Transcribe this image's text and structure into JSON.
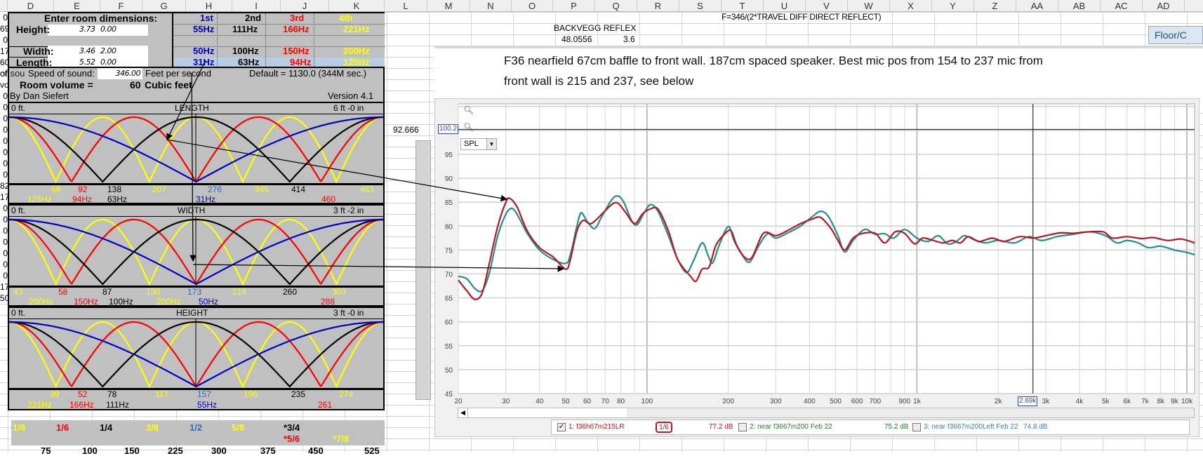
{
  "columns": [
    "D",
    "E",
    "F",
    "G",
    "H",
    "I",
    "J",
    "K",
    "L",
    "M",
    "N",
    "O",
    "P",
    "Q",
    "R",
    "S",
    "T",
    "U",
    "V",
    "W",
    "X",
    "Y",
    "Z",
    "AA",
    "AB",
    "AC",
    "AD"
  ],
  "row_headers": [
    "0",
    "69",
    "0",
    "17",
    "60",
    "of sou",
    "volu",
    "0",
    "0",
    "0",
    "0",
    "0",
    "0",
    "0",
    "0",
    "82",
    "17",
    "0",
    "0",
    "0",
    "0",
    "0",
    "0",
    "0",
    "17",
    "50"
  ],
  "room": {
    "title": "Enter room dimensions:",
    "harmonics": [
      "1st",
      "2nd",
      "3rd",
      "4th"
    ],
    "height": {
      "label": "Height:",
      "meters": "3.73",
      "offset": "0.00",
      "modes": [
        "55Hz",
        "111Hz",
        "166Hz",
        "221Hz"
      ]
    },
    "width": {
      "label": "Width:",
      "meters": "3.46",
      "offset": "2.00",
      "modes": [
        "50Hz",
        "100Hz",
        "150Hz",
        "200Hz"
      ]
    },
    "length": {
      "label": "Length:",
      "meters": "5.52",
      "offset": "0.00",
      "modes": [
        "31Hz",
        "63Hz",
        "94Hz",
        "125Hz"
      ]
    },
    "speed_label": "Speed of sound:",
    "speed_overlap": "of sou",
    "speed": "346.00",
    "speed_unit": "Feet per second",
    "speed_default": "Default = 1130.0 (344M sec.)",
    "volume_label": "Room volume =",
    "volume": "60",
    "volume_unit": "Cubic feet",
    "author": "By Dan Siefert",
    "version": "Version 4.1"
  },
  "panels": {
    "length": {
      "title": "LENGTH",
      "start": "0 ft.",
      "size": "6 ft -0 in",
      "positions": [
        "69",
        "92",
        "138",
        "207",
        "276",
        "345",
        "414",
        "483"
      ],
      "freqs": [
        "125Hz",
        "94Hz",
        "63Hz",
        "31Hz",
        "460"
      ]
    },
    "width": {
      "title": "WIDTH",
      "start": "0 ft.",
      "size": "3 ft -2 in",
      "positions": [
        "43",
        "58",
        "87",
        "130",
        "173",
        "216",
        "260",
        "303"
      ],
      "freqs": [
        "200Hz",
        "150Hz",
        "100Hz",
        "200Hz",
        "50Hz",
        "288"
      ]
    },
    "height": {
      "title": "HEIGHT",
      "start": "0 ft.",
      "size": "3 ft -0 in",
      "positions": [
        "39",
        "52",
        "78",
        "117",
        "157",
        "196",
        "235",
        "274"
      ],
      "freqs": [
        "221Hz",
        "166Hz",
        "111Hz",
        "55Hz",
        "261"
      ]
    }
  },
  "fractions": [
    "1/8",
    "1/6",
    "1/4",
    "3/8",
    "1/2",
    "5/8",
    "*3/4",
    "*5/6",
    "*7/8"
  ],
  "bottom_numbers": [
    "75",
    "100",
    "150",
    "225",
    "300",
    "375",
    "450",
    "525"
  ],
  "sheet_notes": {
    "formula": "F=346/(2*TRAVEL DIFF DIRECT REFLECT)",
    "backvegg": "BACKVEGG REFLEX",
    "val1": "48.0556",
    "val2": "3.6",
    "stray": "92.666",
    "floor_button": "Floor/C"
  },
  "note": {
    "line1": "F36 nearfield 67cm baffle to front wall. 187cm spaced speaker. Best mic pos from 154 to 237 mic from",
    "line2": "front wall is 215 and 237, see below"
  },
  "colors": {
    "yellow": "#ffff00",
    "red": "#ff0000",
    "black": "#000000",
    "blue": "#0000cc",
    "gray": "#c0c0c0",
    "trace1": "#c0141e",
    "trace2": "#1f9090"
  },
  "chart_data": {
    "type": "line",
    "title": "",
    "xlabel": "",
    "ylabel": "SPL",
    "xscale": "log",
    "xlim": [
      20,
      10700
    ],
    "ylim": [
      45,
      105.6
    ],
    "y_ticks": [
      95,
      90,
      85,
      80,
      75,
      70,
      65,
      60,
      55,
      50,
      45
    ],
    "x_ticks": [
      "20",
      "30",
      "40",
      "50",
      "60",
      "70",
      "80",
      "100",
      "200",
      "300",
      "400",
      "500",
      "600",
      "700",
      "900",
      "1k",
      "2k",
      "3k",
      "4k",
      "5k",
      "6k",
      "7k",
      "8k",
      "9k",
      "10k"
    ],
    "x_tick_values": [
      20,
      30,
      40,
      50,
      60,
      70,
      80,
      100,
      200,
      300,
      400,
      500,
      600,
      700,
      900,
      1000,
      2000,
      3000,
      4000,
      5000,
      6000,
      7000,
      8000,
      9000,
      10000
    ],
    "y_cursor": "100.2",
    "x_cursor": "2.69k",
    "x_cursor_value": 2690,
    "y_cursor_value": 100.2,
    "mode_select": "SPL",
    "series": [
      {
        "name": "1: f36h67m215LR",
        "smoothing": "1/6",
        "level": "77.2 dB",
        "checked": true,
        "color": "#c0141e",
        "points": [
          [
            20,
            68.7
          ],
          [
            21.5,
            66.5
          ],
          [
            23,
            64.7
          ],
          [
            24.5,
            66
          ],
          [
            26,
            72
          ],
          [
            28,
            80
          ],
          [
            30,
            85
          ],
          [
            31,
            85.8
          ],
          [
            33,
            84
          ],
          [
            36,
            79
          ],
          [
            40,
            75.5
          ],
          [
            45,
            73.5
          ],
          [
            50,
            71
          ],
          [
            52,
            73
          ],
          [
            55,
            79
          ],
          [
            58,
            81.2
          ],
          [
            62,
            80.5
          ],
          [
            68,
            82.5
          ],
          [
            74,
            84.5
          ],
          [
            78,
            84.8
          ],
          [
            83,
            83
          ],
          [
            90,
            80.5
          ],
          [
            96,
            82.5
          ],
          [
            103,
            83.6
          ],
          [
            110,
            83.5
          ],
          [
            120,
            79
          ],
          [
            130,
            73
          ],
          [
            145,
            69.5
          ],
          [
            152,
            68.5
          ],
          [
            160,
            71
          ],
          [
            170,
            71.5
          ],
          [
            180,
            76
          ],
          [
            195,
            78.5
          ],
          [
            205,
            79
          ],
          [
            215,
            76
          ],
          [
            230,
            73.5
          ],
          [
            245,
            73.5
          ],
          [
            270,
            78.5
          ],
          [
            300,
            78
          ],
          [
            330,
            79
          ],
          [
            370,
            80.5
          ],
          [
            410,
            81.5
          ],
          [
            440,
            81.8
          ],
          [
            480,
            79.5
          ],
          [
            510,
            77
          ],
          [
            540,
            75
          ],
          [
            580,
            77.5
          ],
          [
            630,
            78.5
          ],
          [
            700,
            78.5
          ],
          [
            760,
            76.5
          ],
          [
            830,
            78.8
          ],
          [
            900,
            78.5
          ],
          [
            980,
            76.3
          ],
          [
            1050,
            77.5
          ],
          [
            1150,
            77
          ],
          [
            1250,
            76.5
          ],
          [
            1350,
            77
          ],
          [
            1450,
            76.5
          ],
          [
            1550,
            77.8
          ],
          [
            1700,
            76.8
          ],
          [
            1900,
            77.5
          ],
          [
            2100,
            76.8
          ],
          [
            2400,
            77.8
          ],
          [
            2700,
            77.5
          ],
          [
            3000,
            78
          ],
          [
            3400,
            78.6
          ],
          [
            3800,
            78.5
          ],
          [
            4300,
            78.8
          ],
          [
            4900,
            78.8
          ],
          [
            5300,
            77.5
          ],
          [
            6000,
            77.8
          ],
          [
            6800,
            77.4
          ],
          [
            7500,
            77.6
          ],
          [
            8500,
            77
          ],
          [
            9500,
            77.3
          ],
          [
            10700,
            76.5
          ]
        ]
      },
      {
        "name": "2: near f3667m200 Feb 22",
        "level": "75.2 dB",
        "checked": false,
        "color": "#1f9090",
        "label_color": "#2a7a3a",
        "points": [
          [
            20,
            69.5
          ],
          [
            21.5,
            69
          ],
          [
            23,
            67
          ],
          [
            24.5,
            66.5
          ],
          [
            26,
            70
          ],
          [
            28,
            78
          ],
          [
            30,
            82.5
          ],
          [
            31.5,
            83.7
          ],
          [
            33,
            82.5
          ],
          [
            36,
            78.5
          ],
          [
            40,
            75
          ],
          [
            45,
            73
          ],
          [
            50,
            72.2
          ],
          [
            52,
            74
          ],
          [
            55,
            80
          ],
          [
            57,
            82.8
          ],
          [
            60,
            81
          ],
          [
            64,
            79.5
          ],
          [
            68,
            82
          ],
          [
            74,
            85.5
          ],
          [
            78,
            86.3
          ],
          [
            82,
            85
          ],
          [
            88,
            81
          ],
          [
            92,
            80.3
          ],
          [
            97,
            82.5
          ],
          [
            103,
            84.5
          ],
          [
            110,
            83
          ],
          [
            120,
            78
          ],
          [
            130,
            73
          ],
          [
            140,
            70.3
          ],
          [
            148,
            72.5
          ],
          [
            160,
            76.5
          ],
          [
            168,
            74
          ],
          [
            175,
            72.3
          ],
          [
            185,
            76
          ],
          [
            200,
            79.9
          ],
          [
            210,
            77
          ],
          [
            225,
            74
          ],
          [
            240,
            72.5
          ],
          [
            260,
            76
          ],
          [
            280,
            78.4
          ],
          [
            300,
            77.5
          ],
          [
            330,
            78.5
          ],
          [
            370,
            80
          ],
          [
            410,
            82
          ],
          [
            440,
            83.1
          ],
          [
            470,
            82
          ],
          [
            510,
            78
          ],
          [
            540,
            74.6
          ],
          [
            580,
            77
          ],
          [
            640,
            79.3
          ],
          [
            700,
            78.3
          ],
          [
            760,
            78.4
          ],
          [
            820,
            77.5
          ],
          [
            900,
            79.3
          ],
          [
            1000,
            77.5
          ],
          [
            1100,
            76.8
          ],
          [
            1200,
            78
          ],
          [
            1300,
            76.3
          ],
          [
            1400,
            76.8
          ],
          [
            1500,
            78
          ],
          [
            1650,
            77
          ],
          [
            1800,
            76.5
          ],
          [
            2000,
            77
          ],
          [
            2300,
            76.5
          ],
          [
            2600,
            77.8
          ],
          [
            2900,
            77
          ],
          [
            3300,
            77.8
          ],
          [
            3800,
            78.3
          ],
          [
            4400,
            78.8
          ],
          [
            5000,
            78
          ],
          [
            5500,
            76.5
          ],
          [
            6000,
            77
          ],
          [
            6600,
            76.5
          ],
          [
            7200,
            75.5
          ],
          [
            8000,
            75.8
          ],
          [
            9000,
            75
          ],
          [
            10000,
            74.5
          ],
          [
            10700,
            74
          ]
        ]
      },
      {
        "name": "3: near f3667m200Left Feb 22",
        "level": "74.8 dB",
        "checked": false,
        "color": "#3a7acc",
        "points": []
      }
    ]
  }
}
